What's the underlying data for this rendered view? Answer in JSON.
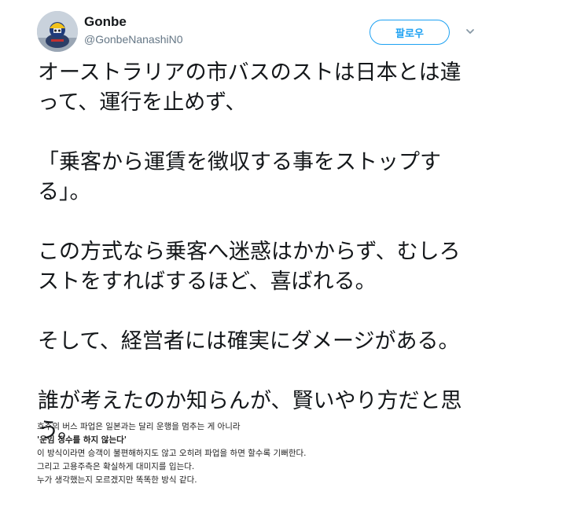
{
  "user": {
    "display_name": "Gonbe",
    "handle": "@GonbeNanashiN0"
  },
  "follow_button": {
    "label": "팔로우"
  },
  "icons": {
    "avatar": "avatar-image",
    "menu": "chevron-down-icon"
  },
  "colors": {
    "accent": "#1da1f2",
    "text": "#14171a",
    "secondary_text": "#657786"
  },
  "tweet": {
    "paragraphs": [
      "オーストラリアの市バスのストは日本とは違\nって、運行を止めず、",
      "「乗客から運賃を徴収する事をストップす\nる」。",
      "この方式なら乗客へ迷惑はかからず、むしろ\nストをすればするほど、喜ばれる。",
      "そして、経営者には確実にダメージがある。",
      "誰が考えたのか知らんが、賢いやり方だと思\nう。"
    ]
  },
  "translation": {
    "lines": [
      "호주의 버스 파업은 일본과는 달리 운행을 멈추는 게 아니라",
      "'운임 징수를 하지 않는다'",
      "이 방식이라면 승객이 불편해하지도 않고 오히려 파업을 하면 할수록 기뻐한다.",
      "그리고 고용주측은 확실하게 대미지를 입는다.",
      "누가 생각했는지 모르겠지만 똑똑한 방식 같다."
    ]
  }
}
